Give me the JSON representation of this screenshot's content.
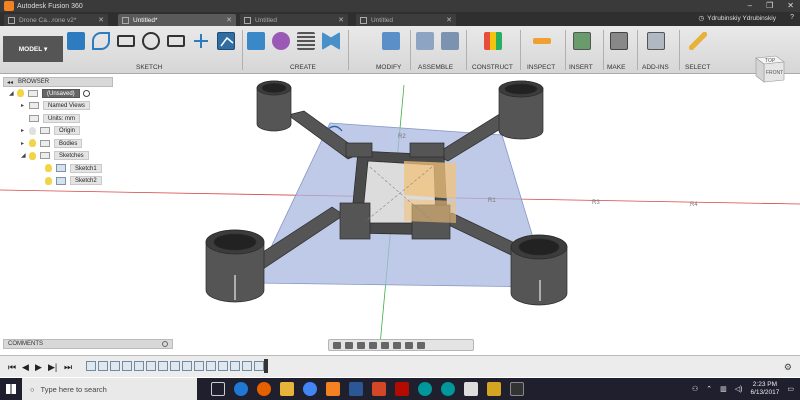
{
  "app": {
    "title": "Autodesk Fusion 360",
    "brand_color": "#f58220"
  },
  "tabs": [
    {
      "label": "Drone Ca...rone v2*",
      "active": false
    },
    {
      "label": "Untitled*",
      "active": true
    },
    {
      "label": "Untitled",
      "active": false
    },
    {
      "label": "Untitled",
      "active": false
    }
  ],
  "user": {
    "name": "Ydrubinskiy Ydrubinskiy"
  },
  "toolbar": {
    "workspace_label": "MODEL",
    "groups": [
      "SKETCH",
      "CREATE",
      "MODIFY",
      "ASSEMBLE",
      "CONSTRUCT",
      "INSPECT",
      "INSERT",
      "MAKE",
      "ADD-INS",
      "SELECT"
    ]
  },
  "browser": {
    "title": "BROWSER",
    "root": "(Unsaved)",
    "items": [
      {
        "label": "Named Views",
        "type": "folder"
      },
      {
        "label": "Units: mm",
        "type": "units"
      },
      {
        "label": "Origin",
        "type": "folder"
      },
      {
        "label": "Bodies",
        "type": "folder"
      },
      {
        "label": "Sketches",
        "type": "folder"
      },
      {
        "label": "Sketch1",
        "type": "sketch"
      },
      {
        "label": "Sketch2",
        "type": "sketch"
      }
    ]
  },
  "viewcube": {
    "top": "TOP",
    "front": "FRONT"
  },
  "comments": {
    "title": "COMMENTS"
  },
  "axis_labels": {
    "r1": "R1",
    "r2": "R2",
    "r3": "R3",
    "r4": "R4",
    "r5": "R1"
  },
  "taskbar": {
    "search_placeholder": "Type here to search",
    "time": "2:23 PM",
    "date": "6/13/2017"
  },
  "colors": {
    "titlebar": "#3a3a3a",
    "grid_plane": "#aab8e0",
    "body": "#4a4a4a",
    "sketch_profile": "#f2c27a",
    "axis_green": "#3cb043",
    "axis_red": "#d64545"
  }
}
